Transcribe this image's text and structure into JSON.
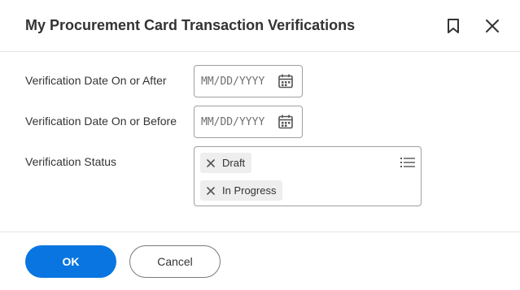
{
  "dialog": {
    "title": "My Procurement Card Transaction Verifications",
    "icons": {
      "bookmark": "bookmark-icon",
      "close": "close-icon"
    }
  },
  "form": {
    "date_after": {
      "label": "Verification Date On or After",
      "placeholder": "MM/DD/YYYY",
      "value": ""
    },
    "date_before": {
      "label": "Verification Date On or Before",
      "placeholder": "MM/DD/YYYY",
      "value": ""
    },
    "status": {
      "label": "Verification Status",
      "selected": [
        "Draft",
        "In Progress"
      ]
    }
  },
  "footer": {
    "ok_label": "OK",
    "cancel_label": "Cancel"
  },
  "colors": {
    "primary": "#0875e1",
    "text": "#333333",
    "border": "#a0a0a0",
    "pill_bg": "#eeeeee"
  }
}
